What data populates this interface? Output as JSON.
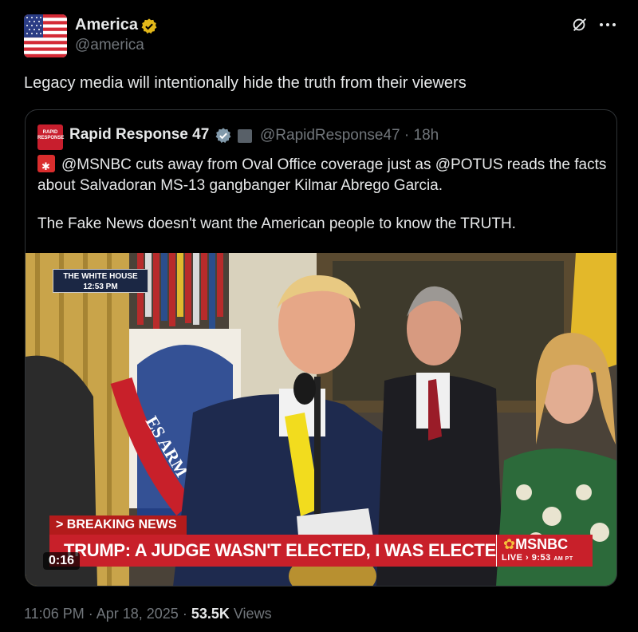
{
  "author": {
    "name": "America",
    "handle": "@america"
  },
  "tweet": {
    "text": "Legacy media will intentionally hide the truth from their viewers",
    "time": "11:06 PM",
    "date": "Apr 18, 2025",
    "views_count": "53.5K",
    "views_label": "Views"
  },
  "quoted": {
    "avatar_text": "RAPID RESPONSE",
    "name": "Rapid Response 47",
    "handle_time": "@RapidResponse47 · 18h",
    "text_line1": "@MSNBC cuts away from Oval Office coverage just as @POTUS reads the facts about Salvadoran MS-13 gangbanger Kilmar Abrego Garcia.",
    "text_line2": "The Fake News doesn't want the American people to know the TRUTH."
  },
  "video": {
    "bug_title": "THE WHITE HOUSE",
    "bug_time": "12:53 PM",
    "breaking": "> BREAKING NEWS",
    "headline": "TRUMP: A JUDGE WASN'T ELECTED, I WAS ELECTED",
    "network": "MSNBC",
    "live": "LIVE",
    "live_time": "› 9:53",
    "live_ampm": "AM PT",
    "duration": "0:16",
    "background_sign": "ES ARM"
  },
  "icons": {
    "verified": "verified-gold-badge-icon",
    "grok": "grok-icon",
    "more": "more-options-icon",
    "flag": "us-flag-avatar",
    "building": "government-building-icon"
  },
  "colors": {
    "background": "#000000",
    "text": "#e7e9ea",
    "muted": "#71767b",
    "gold_badge": "#e2b719",
    "blue_badge": "#1d9bf0",
    "breaking_red": "#c8202a"
  }
}
